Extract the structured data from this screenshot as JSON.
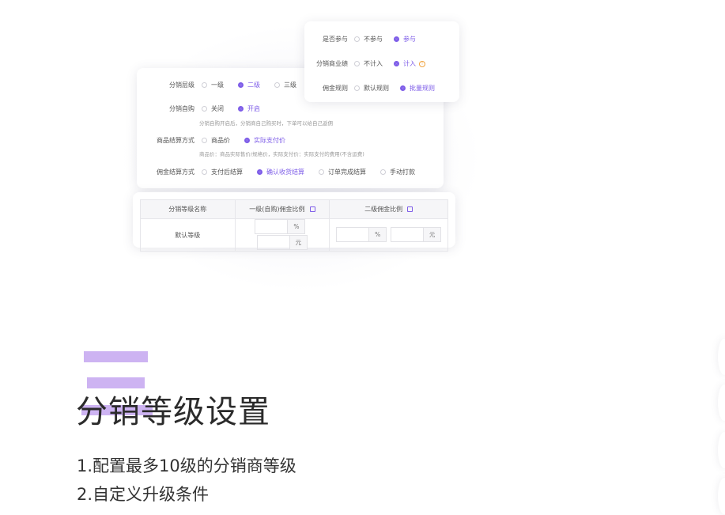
{
  "main_card": {
    "rows": [
      {
        "label": "分销层级",
        "options": [
          "一级",
          "二级",
          "三级"
        ],
        "selected": 1
      },
      {
        "label": "分销自购",
        "options": [
          "关闭",
          "开启"
        ],
        "selected": 1,
        "hint": "分销自购开启后，分销商自己购买时，下单可以给自己返佣"
      },
      {
        "label": "商品结算方式",
        "options": [
          "商品价",
          "实际支付价"
        ],
        "selected": 1,
        "hint": "商品价：商品实际售价/规格价，实际支付价：实际支付的费用(不含运费)"
      },
      {
        "label": "佣金结算方式",
        "options": [
          "支付后结算",
          "确认收货结算",
          "订单完成结算",
          "手动打款"
        ],
        "selected": 1
      }
    ]
  },
  "float_card": {
    "rows": [
      {
        "label": "是否参与",
        "options": [
          "不参与",
          "参与"
        ],
        "selected": 1
      },
      {
        "label": "分销商业绩",
        "options": [
          "不计入",
          "计入"
        ],
        "selected": 1,
        "warn_icon": "!"
      },
      {
        "label": "佣金规则",
        "options": [
          "默认规则",
          "批量规则"
        ],
        "selected": 1
      }
    ]
  },
  "table": {
    "headers": [
      "分销等级名称",
      "一级(自购)佣金比例",
      "二级佣金比例"
    ],
    "row": {
      "name": "默认等级",
      "unit_percent": "%",
      "unit_yuan": "元"
    }
  },
  "section": {
    "title": "分销等级设置",
    "items": [
      "1.配置最多10级的分销商等级",
      "2.自定义升级条件"
    ]
  },
  "colors": {
    "accent": "#7d5ce8",
    "deco": "#cdb3f2"
  }
}
